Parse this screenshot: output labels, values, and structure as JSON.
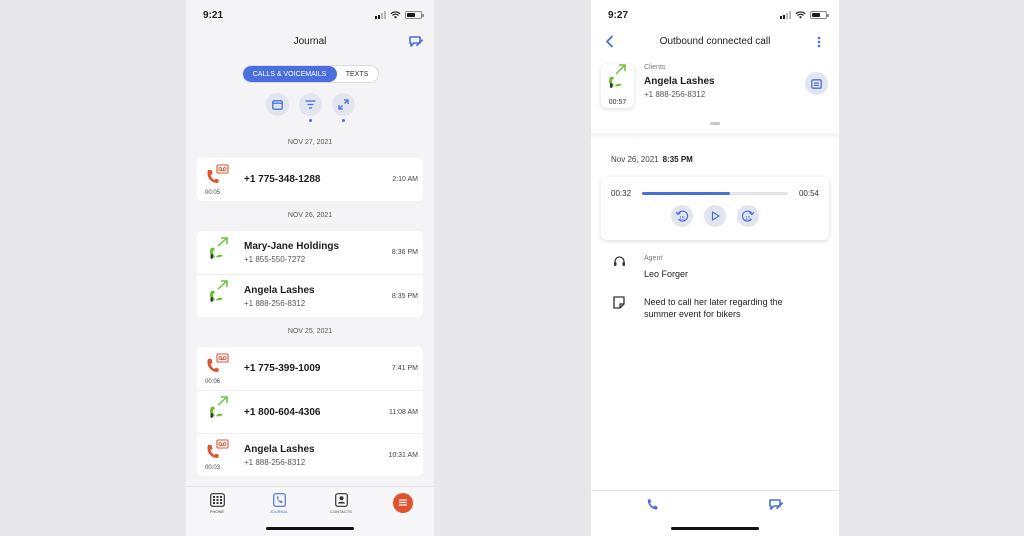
{
  "colors": {
    "accent": "#4a6fdc",
    "missed": "#e0532c",
    "outbound": "#6cbf3a",
    "fab": "#e0532c"
  },
  "left": {
    "status_time": "9:21",
    "title": "Journal",
    "tabs": [
      "CALLS & VOICEMAILS",
      "TEXTS"
    ],
    "toolbar_icons": [
      "calendar-icon",
      "filter-icon",
      "expand-icon"
    ],
    "groups": [
      {
        "date": "NOV 27, 2021",
        "rows": [
          {
            "type": "voicemail",
            "name": "+1 775-348-1288",
            "number": "",
            "duration": "00:05",
            "time": "2:10 AM"
          }
        ]
      },
      {
        "date": "NOV 26, 2021",
        "rows": [
          {
            "type": "outbound",
            "name": "Mary-Jane Holdings",
            "number": "+1 855-550-7272",
            "duration": "",
            "time": "8:36 PM"
          },
          {
            "type": "outbound",
            "name": "Angela Lashes",
            "number": "+1 888-256-8312",
            "duration": "",
            "time": "8:35 PM"
          }
        ]
      },
      {
        "date": "NOV 25, 2021",
        "rows": [
          {
            "type": "voicemail",
            "name": "+1 775-399-1009",
            "number": "",
            "duration": "00:06",
            "time": "7:41 PM"
          },
          {
            "type": "outbound",
            "name": "+1 800-604-4306",
            "number": "",
            "duration": "",
            "time": "11:08 AM"
          },
          {
            "type": "voicemail",
            "name": "Angela Lashes",
            "number": "+1 888-256-8312",
            "duration": "00:03",
            "time": "10:31 AM"
          }
        ]
      }
    ],
    "nav": {
      "phone": "PHONE",
      "journal": "JOURNAL",
      "contacts": "CONTACTS"
    }
  },
  "right": {
    "status_time": "9:27",
    "title": "Outbound connected call",
    "contact": {
      "category": "Clients",
      "name": "Angela Lashes",
      "number": "+1 888-256-8312",
      "duration": "00:57"
    },
    "call_date": "Nov 26, 2021",
    "call_time": "8:35 PM",
    "player": {
      "elapsed": "00:32",
      "total": "00:54",
      "progress": 0.6,
      "skip_seconds": "15"
    },
    "agent_label": "Agent",
    "agent_name": "Leo Forger",
    "note": "Need to call her later regarding the summer event for bikers"
  }
}
